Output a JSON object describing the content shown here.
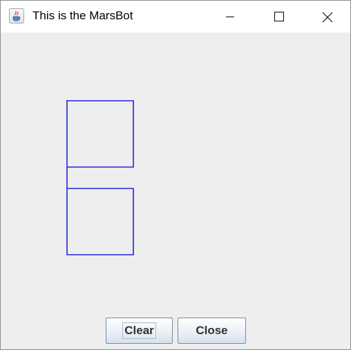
{
  "window": {
    "title": "This is the MarsBot",
    "app_icon": "java-cup-icon",
    "controls": {
      "minimize_icon": "minimize-icon",
      "maximize_icon": "maximize-icon",
      "close_icon": "close-icon"
    }
  },
  "drawing": {
    "stroke_color": "#2222dd",
    "background_color": "#eeeeee"
  },
  "buttons": {
    "clear_label": "Clear",
    "close_label": "Close"
  }
}
